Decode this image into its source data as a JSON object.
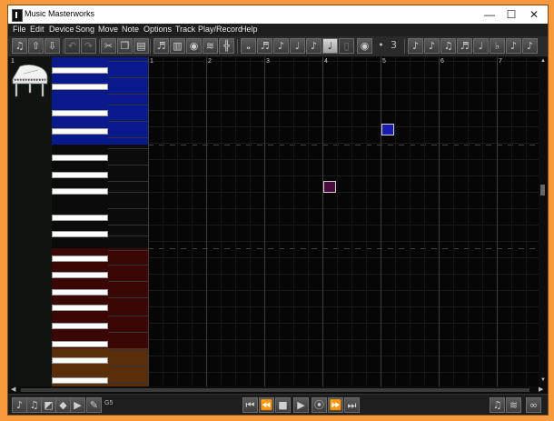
{
  "window": {
    "title": "Music Masterworks",
    "controls": [
      "—",
      "☐",
      "✕"
    ]
  },
  "menu": [
    "File",
    "Edit",
    "Device",
    "Song",
    "Move",
    "Note",
    "Options",
    "Track",
    "Play/Record",
    "Help"
  ],
  "toolbar": {
    "buttons": [
      {
        "icon": "music-note-icon",
        "glyph": "♫"
      },
      {
        "icon": "upload-icon",
        "glyph": "⇧"
      },
      {
        "icon": "download-icon",
        "glyph": "⇩"
      },
      {
        "icon": "undo-icon",
        "glyph": "↶"
      },
      {
        "icon": "redo-icon",
        "glyph": "↷"
      },
      {
        "icon": "cut-icon",
        "glyph": "✂"
      },
      {
        "icon": "copy-icon",
        "glyph": "❐"
      },
      {
        "icon": "paste-icon",
        "glyph": "▤"
      },
      {
        "icon": "score-icon",
        "glyph": "♬"
      },
      {
        "icon": "keyboard-icon",
        "glyph": "▥"
      },
      {
        "icon": "record-disc-icon",
        "glyph": "◉"
      },
      {
        "icon": "waveform-icon",
        "glyph": "≋"
      },
      {
        "icon": "split-icon",
        "glyph": "╬"
      },
      {
        "icon": "whole-note-icon",
        "glyph": "𝅝"
      },
      {
        "icon": "sixteenth-note-icon",
        "glyph": "♬"
      },
      {
        "icon": "eighth-note-icon",
        "glyph": "♪"
      },
      {
        "icon": "quarter-note-icon",
        "glyph": "♩"
      },
      {
        "icon": "half-note-icon",
        "glyph": "♪"
      },
      {
        "icon": "note-selected-icon",
        "glyph": "♩"
      },
      {
        "icon": "note-outline-icon",
        "glyph": "▯"
      },
      {
        "icon": "eye-icon",
        "glyph": "◉"
      },
      {
        "icon": "dot-icon",
        "glyph": "•"
      },
      {
        "icon": "triplet-icon",
        "glyph": "3"
      },
      {
        "icon": "note-right-icon",
        "glyph": "♪"
      },
      {
        "icon": "note-forward-icon",
        "glyph": "♪"
      },
      {
        "icon": "notes-pair-icon",
        "glyph": "♫"
      },
      {
        "icon": "notes-up-icon",
        "glyph": "♬"
      },
      {
        "icon": "note-up-icon",
        "glyph": "♩"
      },
      {
        "icon": "note-flat-icon",
        "glyph": "♭"
      },
      {
        "icon": "note-left-icon",
        "glyph": "♪"
      },
      {
        "icon": "note-back-icon",
        "glyph": "♪"
      }
    ]
  },
  "track": {
    "number": "1",
    "instrument_icon": "grand-piano-icon"
  },
  "bars": [
    "1",
    "2",
    "3",
    "4",
    "5",
    "6",
    "7"
  ],
  "keyboard": {
    "band_colors": [
      "#0a1a8c",
      "#0b0b0b",
      "#3a0606",
      "#5a2e08"
    ]
  },
  "notes": [
    {
      "bar": 4,
      "color": "#4a0a3c",
      "label": "note-bar4"
    },
    {
      "bar": 5,
      "color": "#1a1ab0",
      "label": "note-bar5"
    }
  ],
  "transport": {
    "left_buttons": [
      {
        "icon": "music-note-icon",
        "glyph": "♪"
      },
      {
        "icon": "notes-list-icon",
        "glyph": "♫"
      },
      {
        "icon": "chart-icon",
        "glyph": "◩"
      },
      {
        "icon": "eraser-icon",
        "glyph": "◆"
      },
      {
        "icon": "record-mode-icon",
        "glyph": "▶"
      },
      {
        "icon": "pen-icon",
        "glyph": "✎"
      }
    ],
    "counter": "G5",
    "center_buttons": [
      {
        "icon": "skip-back-icon",
        "glyph": "⏮"
      },
      {
        "icon": "rewind-icon",
        "glyph": "⏪"
      },
      {
        "icon": "stop-icon",
        "glyph": "■"
      },
      {
        "icon": "play-icon",
        "glyph": "▶"
      },
      {
        "icon": "record-icon",
        "glyph": "⦿"
      },
      {
        "icon": "fast-forward-icon",
        "glyph": "⏩"
      },
      {
        "icon": "skip-forward-icon",
        "glyph": "⏭"
      }
    ],
    "right_buttons": [
      {
        "icon": "microphone-icon",
        "glyph": "♫"
      },
      {
        "icon": "audio-wave-icon",
        "glyph": "≋"
      },
      {
        "icon": "voicemail-icon",
        "glyph": "∞"
      }
    ]
  }
}
